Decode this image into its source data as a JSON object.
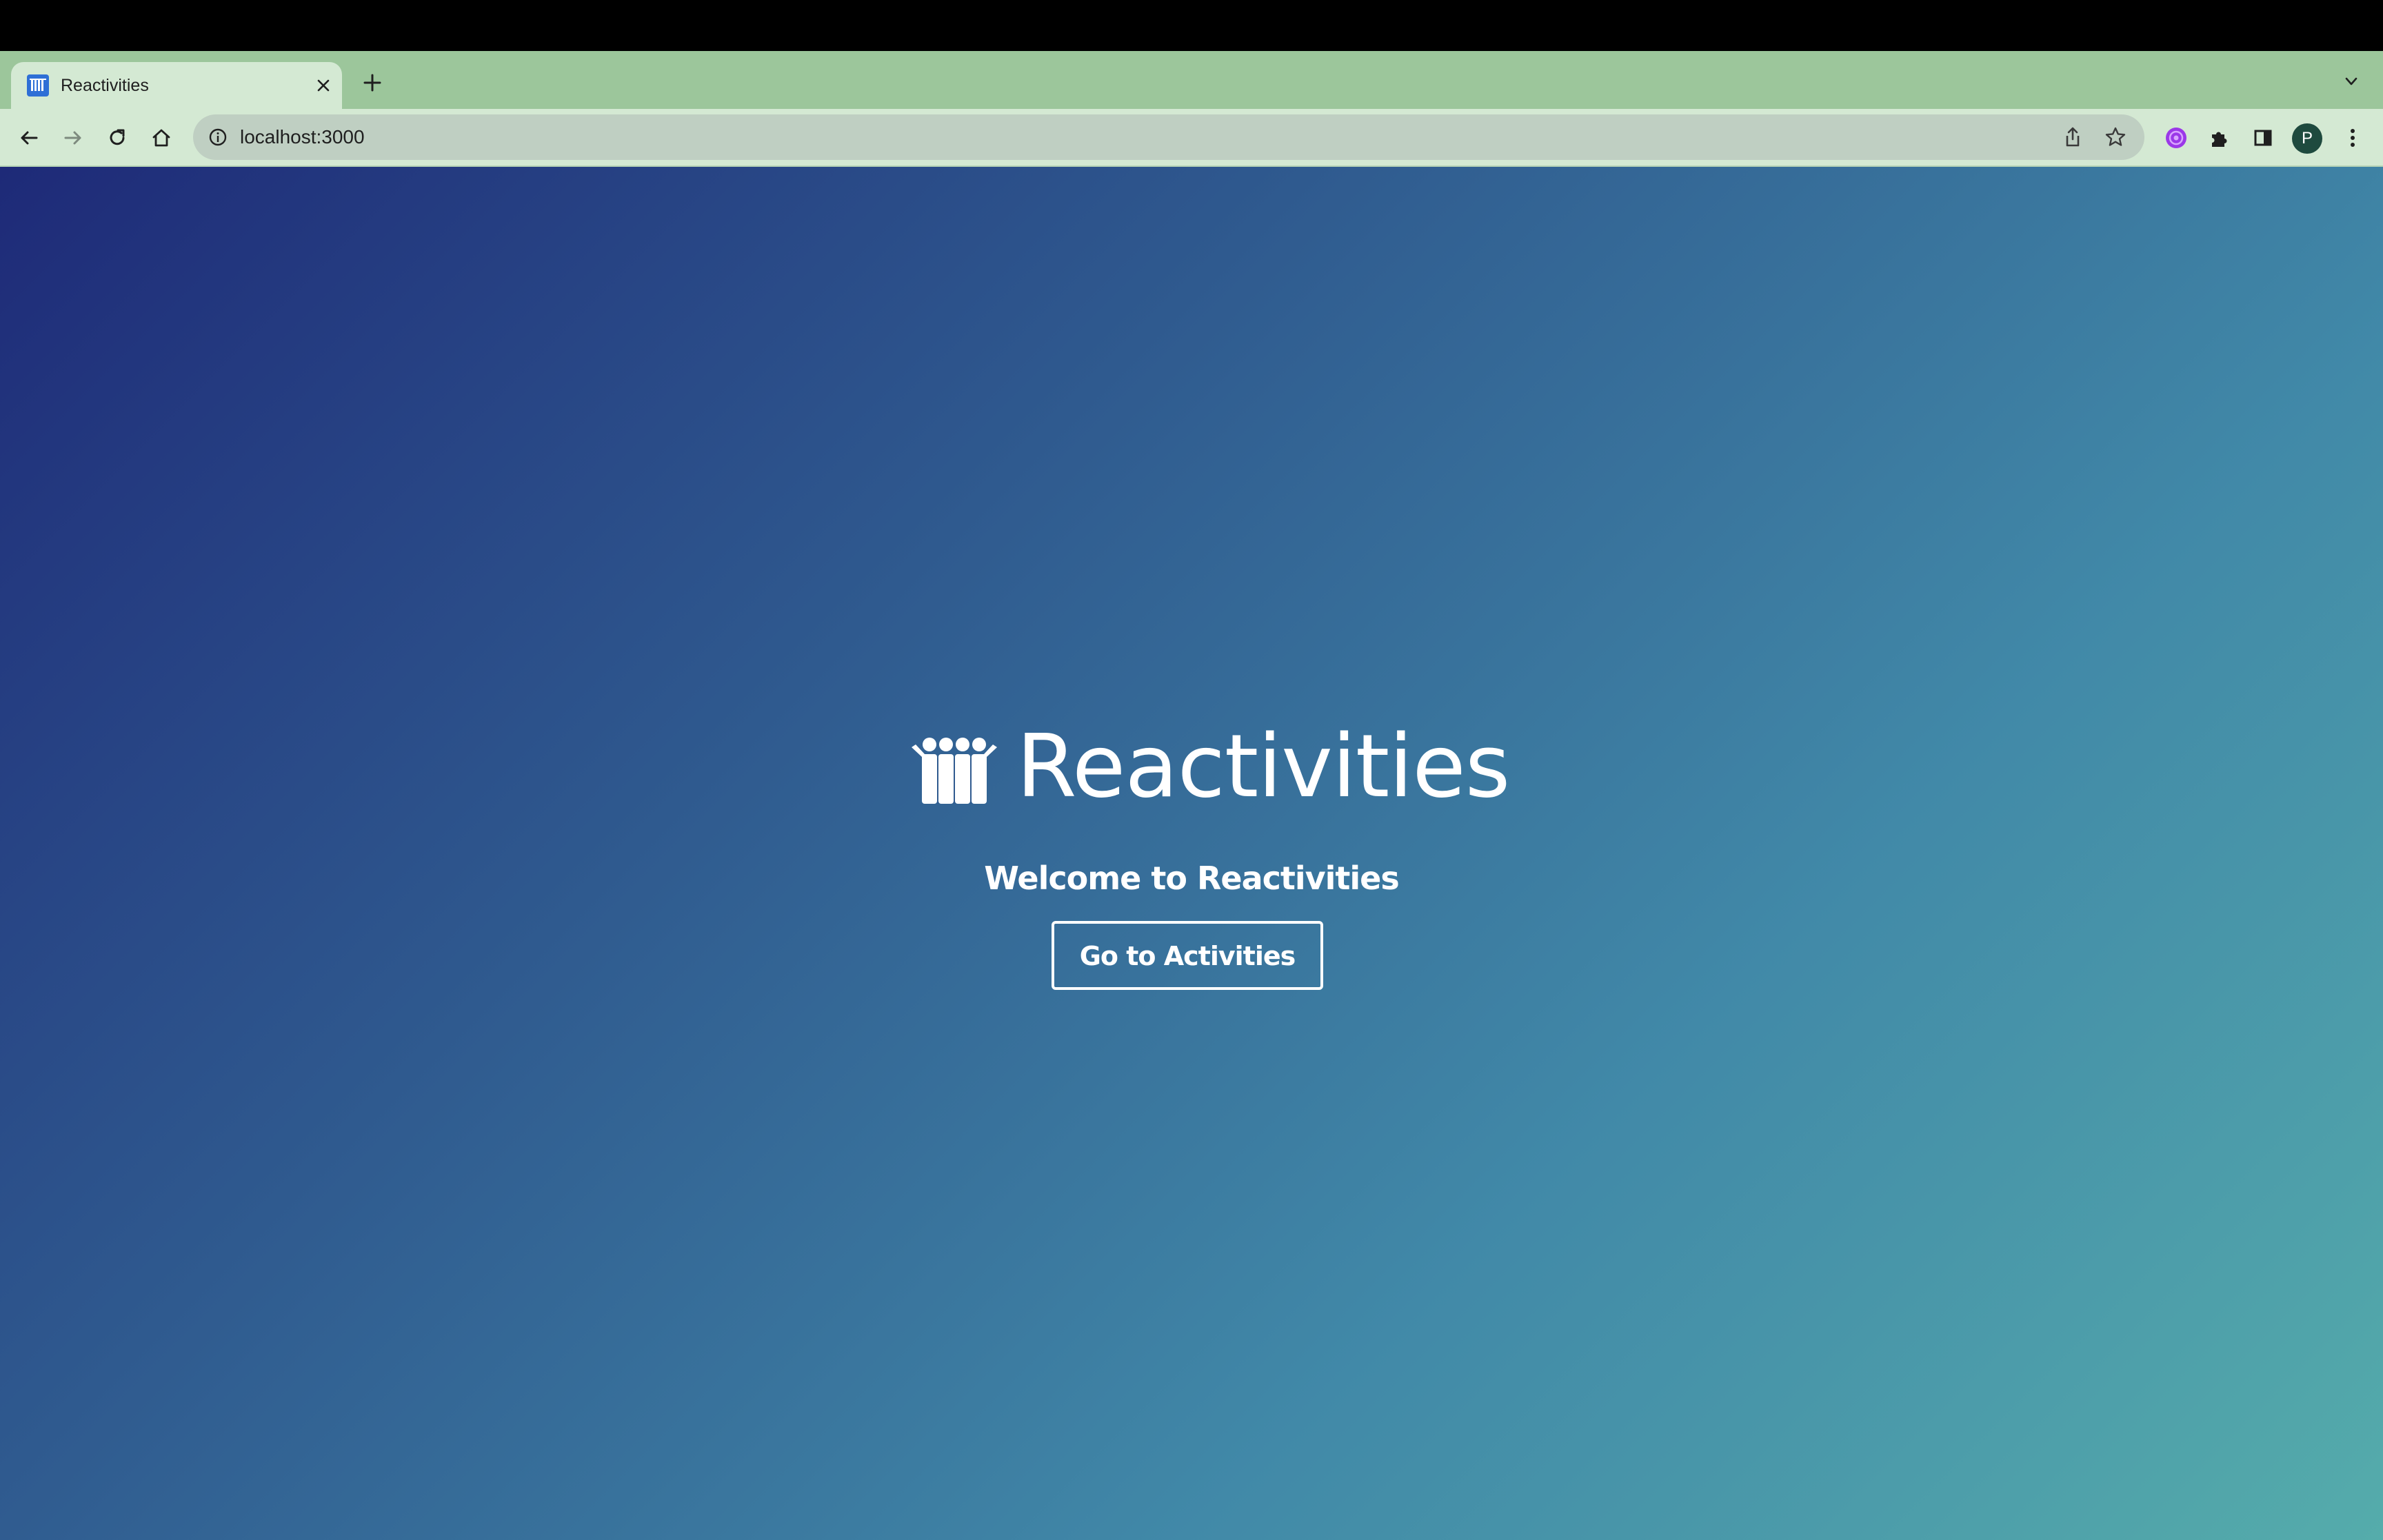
{
  "browser": {
    "tab": {
      "title": "Reactivities",
      "favicon": "users-icon"
    },
    "new_tab_icon": "plus-icon",
    "tab_search_icon": "chevron-down-icon",
    "toolbar": {
      "back_icon": "arrow-left-icon",
      "forward_icon": "arrow-right-icon",
      "reload_icon": "reload-icon",
      "home_icon": "home-icon"
    },
    "omnibox": {
      "url": "localhost:3000",
      "info_icon": "info-icon",
      "share_icon": "share-icon",
      "bookmark_icon": "star-icon"
    },
    "extensions": {
      "extension_icon": "extension-avatar-icon",
      "puzzle_icon": "puzzle-icon",
      "side_panel_icon": "side-panel-icon"
    },
    "profile": {
      "initial": "P"
    },
    "menu_icon": "kebab-menu-icon"
  },
  "page": {
    "brand_title": "Reactivities",
    "brand_icon": "users-icon",
    "welcome": "Welcome to Reactivities",
    "cta_label": "Go to Activities"
  },
  "colors": {
    "tabstrip": "#9cc69b",
    "toolbar": "#d4e9d3",
    "omnibox": "#bfcfc2",
    "gradient_start": "#1e2a78",
    "gradient_end": "#55acab",
    "accent_text": "#ffffff"
  }
}
